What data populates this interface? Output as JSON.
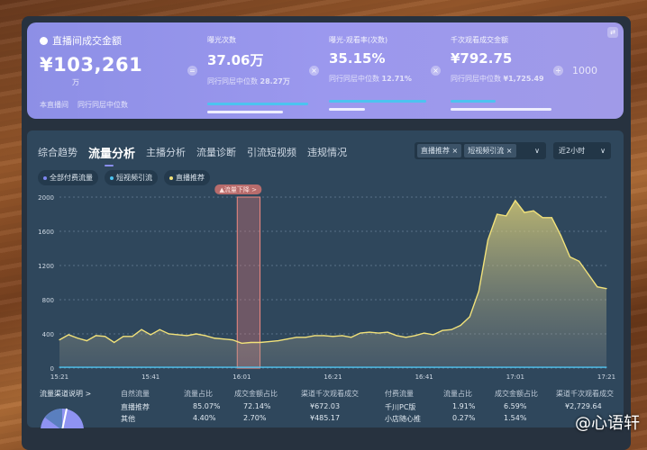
{
  "summary": {
    "title": "直播间成交金额",
    "value": "¥103,261",
    "unit": "万",
    "legend": [
      "本直播间",
      "同行同层中位数"
    ],
    "kpis": [
      {
        "label": "曝光次数",
        "value": "37.06万",
        "median_label": "同行同层中位数",
        "median": "28.27万",
        "op": "×",
        "bar": 0.93,
        "median_bar": 0.7
      },
      {
        "label": "曝光-观看率(次数)",
        "value": "35.15%",
        "median_label": "同行同层中位数",
        "median": "12.71%",
        "op": "×",
        "bar": 0.9,
        "median_bar": 0.33
      },
      {
        "label": "千次观看成交金额",
        "value": "¥792.75",
        "median_label": "同行同层中位数",
        "median": "¥1,725.49",
        "op": "÷",
        "bar": 0.42,
        "median_bar": 0.93
      }
    ],
    "divisor_op": "÷",
    "divisor": "1000",
    "first_op": "="
  },
  "tabs": [
    "综合趋势",
    "流量分析",
    "主播分析",
    "流量诊断",
    "引流短视频",
    "违规情况"
  ],
  "active_tab": 1,
  "filter": {
    "chips": [
      "直播推荐 ×",
      "短视频引流 ×"
    ],
    "arrow": "∨"
  },
  "range": {
    "value": "近2小时",
    "arrow": "∨"
  },
  "series_pills": [
    {
      "label": "全部付费流量",
      "color": "#7d86f0"
    },
    {
      "label": "短视频引流",
      "color": "#4cc3f0"
    },
    {
      "label": "直播推荐",
      "color": "#f2e27a"
    }
  ],
  "alert": "▲流量下降 >",
  "chart_data": {
    "type": "area",
    "ylim": [
      0,
      2000
    ],
    "yticks": [
      0,
      400,
      800,
      1200,
      1600,
      2000
    ],
    "xticks": [
      "15:21",
      "15:41",
      "16:01",
      "16:21",
      "16:41",
      "17:01",
      "17:21"
    ],
    "x_start_min": 0,
    "x_end_min": 120,
    "step_min": 2,
    "highlight_range_min": [
      39,
      44
    ],
    "series": [
      {
        "name": "直播推荐",
        "color": "#f2e27a",
        "values": [
          330,
          390,
          350,
          320,
          380,
          370,
          300,
          370,
          370,
          450,
          390,
          450,
          400,
          390,
          380,
          400,
          380,
          350,
          340,
          330,
          290,
          300,
          300,
          310,
          320,
          340,
          360,
          360,
          380,
          380,
          370,
          380,
          360,
          410,
          420,
          410,
          420,
          380,
          360,
          380,
          410,
          390,
          440,
          450,
          500,
          600,
          900,
          1500,
          1800,
          1780,
          1960,
          1820,
          1840,
          1760,
          1760,
          1550,
          1300,
          1250,
          1100,
          950,
          930
        ]
      },
      {
        "name": "短视频引流",
        "color": "#4cc3f0",
        "values": [
          10,
          10,
          10,
          10,
          10,
          10,
          10,
          10,
          10,
          10,
          10,
          10,
          10,
          10,
          10,
          10,
          10,
          10,
          10,
          10,
          10,
          10,
          10,
          10,
          10,
          10,
          10,
          10,
          10,
          10,
          10,
          10,
          10,
          10,
          10,
          10,
          10,
          10,
          10,
          10,
          10,
          10,
          10,
          10,
          10,
          10,
          10,
          10,
          10,
          10,
          10,
          10,
          10,
          10,
          10,
          10,
          10,
          10,
          10,
          10,
          10
        ]
      }
    ]
  },
  "channels": {
    "link": "流量渠道说明 >",
    "headers": [
      "自然流量",
      "流量占比",
      "成交金额占比",
      "渠道千次观看成交",
      "付费流量",
      "流量占比",
      "成交金额占比",
      "渠道千次观看成交"
    ],
    "rows": [
      [
        "直播推荐",
        "85.07%",
        "72.14%",
        "¥672.03",
        "千川PC版",
        "1.91%",
        "6.59%",
        "¥2,729.64"
      ],
      [
        "其他",
        "4.40%",
        "2.70%",
        "¥485.17",
        "小店随心推",
        "0.27%",
        "1.54%",
        ""
      ]
    ]
  },
  "watermark": "@心语轩"
}
